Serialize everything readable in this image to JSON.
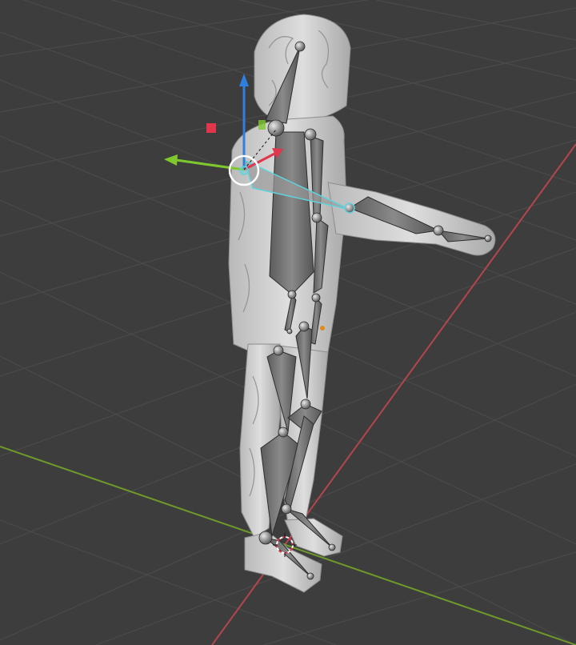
{
  "viewport": {
    "background": "#3d3d3d",
    "grid_color": "#4a4a4a",
    "x_axis_color": "#b4454f",
    "y_axis_color": "#6f9a2a"
  },
  "gizmo": {
    "z_color": "#2f7fe0",
    "y_color": "#7ec82e",
    "x_color": "#e0374e"
  },
  "armature": {
    "selected_bone_color": "#5ed4de",
    "bone_color": "#6e6e6e"
  },
  "mesh": {
    "color": "#d0d0d0",
    "name": "character-mesh"
  }
}
